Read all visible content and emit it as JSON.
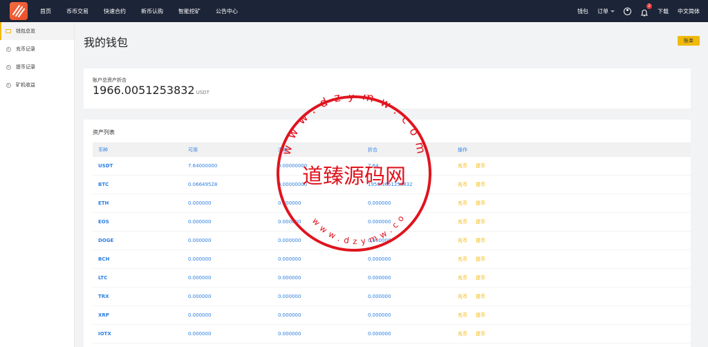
{
  "header": {
    "logo_text": "LE",
    "nav": [
      "首页",
      "币币交易",
      "快速合约",
      "新币认购",
      "智能挖矿",
      "公告中心"
    ],
    "right": {
      "wallet": "钱包",
      "orders": "订单",
      "notification_count": "2",
      "download": "下载",
      "language": "中文简体"
    }
  },
  "sidebar": {
    "items": [
      {
        "label": "钱包总览",
        "icon": "wallet-icon",
        "active": true
      },
      {
        "label": "充币记录",
        "icon": "coin-icon",
        "active": false
      },
      {
        "label": "提币记录",
        "icon": "coin-icon",
        "active": false
      },
      {
        "label": "矿机收益",
        "icon": "coin-icon",
        "active": false
      }
    ]
  },
  "page": {
    "title": "我的钱包",
    "bill_button": "账单"
  },
  "asset": {
    "label": "账户总资产折合",
    "value": "1966.0051253832",
    "unit": "USDT"
  },
  "asset_list": {
    "title": "资产列表",
    "columns": [
      "币种",
      "可用",
      "冻结",
      "折合",
      "操作"
    ],
    "rows": [
      {
        "coin": "USDT",
        "available": "7.64000000",
        "frozen": "0.00000000",
        "converted": "7.64"
      },
      {
        "coin": "BTC",
        "available": "0.06649528",
        "frozen": "0.00000000",
        "converted": "1958.3651253832"
      },
      {
        "coin": "ETH",
        "available": "0.000000",
        "frozen": "0.000000",
        "converted": "0.000000"
      },
      {
        "coin": "EOS",
        "available": "0.000000",
        "frozen": "0.000000",
        "converted": "0.000000"
      },
      {
        "coin": "DOGE",
        "available": "0.000000",
        "frozen": "0.000000",
        "converted": "0.000000"
      },
      {
        "coin": "BCH",
        "available": "0.000000",
        "frozen": "0.000000",
        "converted": "0.000000"
      },
      {
        "coin": "LTC",
        "available": "0.000000",
        "frozen": "0.000000",
        "converted": "0.000000"
      },
      {
        "coin": "TRX",
        "available": "0.000000",
        "frozen": "0.000000",
        "converted": "0.000000"
      },
      {
        "coin": "XRP",
        "available": "0.000000",
        "frozen": "0.000000",
        "converted": "0.000000"
      },
      {
        "coin": "IOTX",
        "available": "0.000000",
        "frozen": "0.000000",
        "converted": "0.000000"
      }
    ],
    "action_deposit": "充币",
    "action_withdraw": "提币"
  },
  "watermark": {
    "text": "道臻源码网",
    "url_top": "www.dzymw.com",
    "url_bottom": "www.dzymw.com"
  },
  "colors": {
    "topbar": "#1c2437",
    "accent": "#f0b90b",
    "link_blue": "#2a7de1",
    "watermark_red": "#e0141e"
  }
}
